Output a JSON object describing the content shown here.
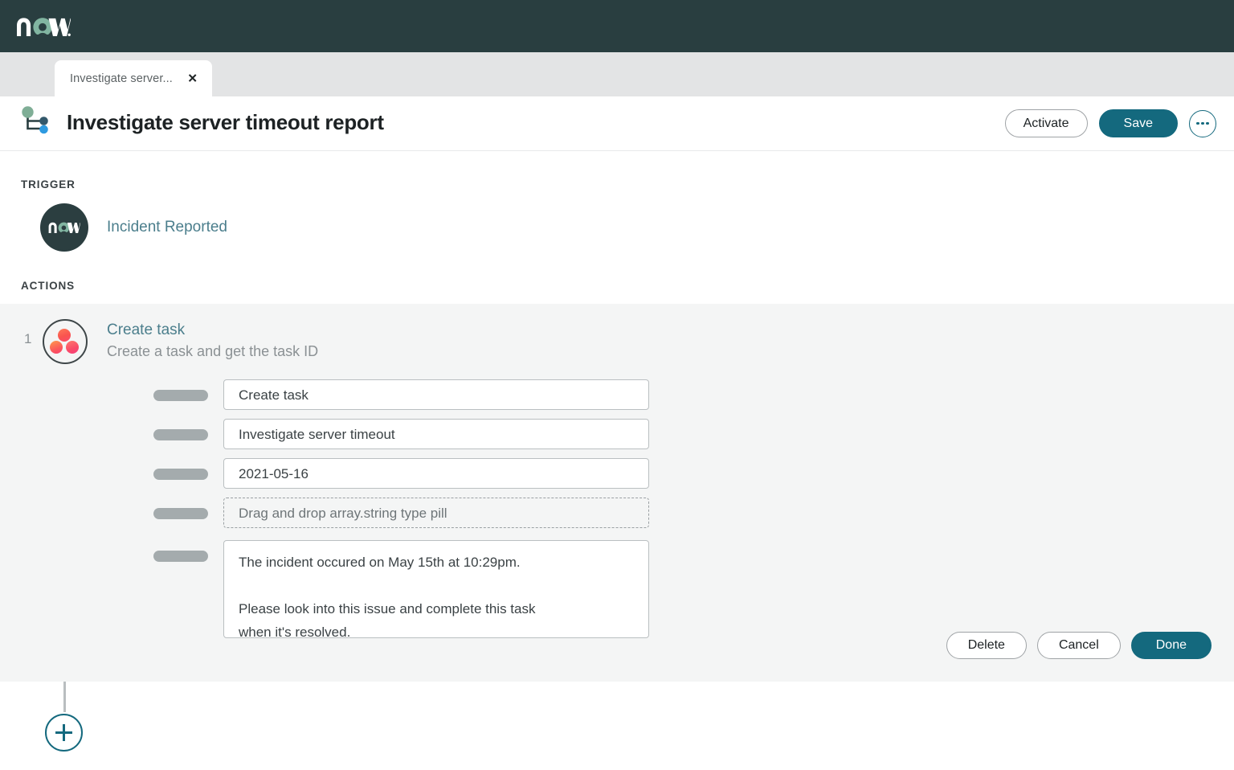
{
  "brand": {
    "logo_text": "now",
    "logo_icon": "servicenow-logo"
  },
  "tab": {
    "label": "Investigate server...",
    "close_icon": "close-icon"
  },
  "header": {
    "flow_icon": "flow-branch-icon",
    "title": "Investigate server timeout report",
    "activate_label": "Activate",
    "save_label": "Save",
    "more_icon": "more-horizontal-icon"
  },
  "trigger": {
    "section_label": "TRIGGER",
    "icon": "servicenow-now-circle-icon",
    "icon_text": "now",
    "name": "Incident Reported"
  },
  "actions": {
    "section_label": "ACTIONS",
    "items": [
      {
        "index": "1",
        "icon": "asana-three-dots-icon",
        "title": "Create task",
        "description": "Create a task and get the task ID",
        "fields": [
          {
            "name": "action-field",
            "value": "Create task",
            "type": "text"
          },
          {
            "name": "task-name-field",
            "value": "Investigate server timeout",
            "type": "text"
          },
          {
            "name": "due-date-field",
            "value": "2021-05-16",
            "type": "text"
          },
          {
            "name": "followers-dropzone",
            "value": "Drag and drop array.string type pill",
            "type": "dropzone"
          },
          {
            "name": "notes-field",
            "value": "The incident occured on May 15th at 10:29pm.\n\nPlease look into this issue and complete this task\nwhen it's resolved.",
            "type": "textarea"
          }
        ],
        "delete_label": "Delete",
        "cancel_label": "Cancel",
        "done_label": "Done"
      }
    ]
  },
  "add_step": {
    "icon": "plus-icon"
  },
  "colors": {
    "brand_bar": "#293e40",
    "accent_teal": "#14697e",
    "link_teal": "#4b7e8c",
    "panel_bg": "#f4f5f5",
    "label_pill": "#a4abad"
  }
}
